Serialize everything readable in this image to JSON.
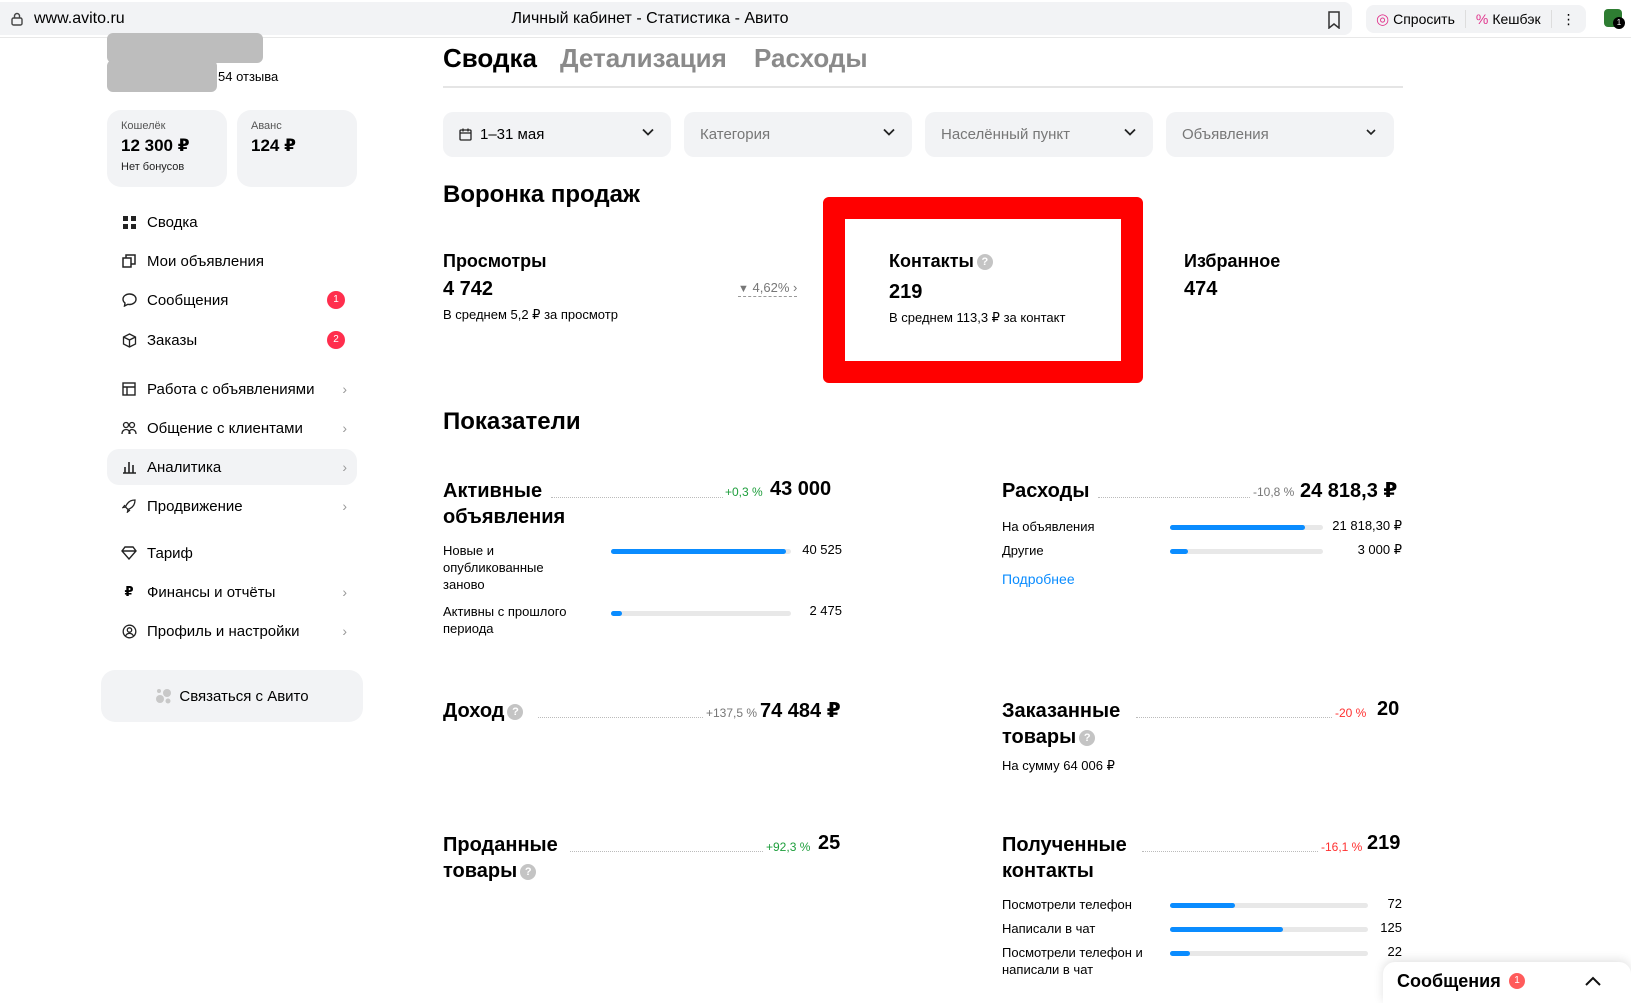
{
  "browser": {
    "url": "www.avito.ru",
    "title": "Личный кабинет - Статистика - Авито",
    "ask_label": "Спросить",
    "cashback_label": "Кешбэк",
    "menu_dots": "⋮",
    "ext_badge": "1"
  },
  "sidebar": {
    "reviews": "54 отзыва",
    "wallet": {
      "label": "Кошелёк",
      "value": "12 300 ₽",
      "sub": "Нет бонусов"
    },
    "advance": {
      "label": "Аванс",
      "value": "124 ₽"
    },
    "items": [
      {
        "label": "Сводка",
        "icon": "grid-icon"
      },
      {
        "label": "Мои объявления",
        "icon": "copy-icon"
      },
      {
        "label": "Сообщения",
        "icon": "chat-icon",
        "badge": "1"
      },
      {
        "label": "Заказы",
        "icon": "box-icon",
        "badge": "2"
      },
      {
        "label": "Работа с объявлениями",
        "icon": "listing-icon"
      },
      {
        "label": "Общение с клиентами",
        "icon": "people-icon"
      },
      {
        "label": "Аналитика",
        "icon": "chart-icon"
      },
      {
        "label": "Продвижение",
        "icon": "rocket-icon"
      },
      {
        "label": "Тариф",
        "icon": "diamond-icon"
      },
      {
        "label": "Финансы и отчёты",
        "icon": "ruble-icon"
      },
      {
        "label": "Профиль и настройки",
        "icon": "user-icon"
      }
    ],
    "contact_button": "Связаться с Авито"
  },
  "tabs": [
    "Сводка",
    "Детализация",
    "Расходы"
  ],
  "filters": {
    "date": "1–31 мая",
    "category": "Категория",
    "city": "Населённый пункт",
    "ads": "Объявления"
  },
  "funnel": {
    "title": "Воронка продаж",
    "views": {
      "label": "Просмотры",
      "value": "4 742",
      "sub": "В среднем 5,2 ₽ за просмотр"
    },
    "conversion": "4,62%",
    "contacts": {
      "label": "Контакты",
      "value": "219",
      "sub": "В среднем 113,3 ₽ за контакт"
    },
    "favorites": {
      "label": "Избранное",
      "value": "474"
    }
  },
  "indicators": {
    "title": "Показатели",
    "active_ads": {
      "title_line1": "Активные",
      "title_line2": "объявления",
      "change": "+0,3 %",
      "value": "43 000",
      "rows": [
        {
          "label": "Новые и опубликованные заново",
          "value": "40 525",
          "fill": 0.97
        },
        {
          "label": "Активны с прошлого периода",
          "value": "2 475",
          "fill": 0.06
        }
      ]
    },
    "expenses": {
      "title": "Расходы",
      "change": "-10,8 %",
      "value": "24 818,3 ₽",
      "rows": [
        {
          "label": "На объявления",
          "value": "21 818,30 ₽",
          "fill": 0.88
        },
        {
          "label": "Другие",
          "value": "3 000 ₽",
          "fill": 0.12
        }
      ],
      "more_link": "Подробнее"
    },
    "income": {
      "title": "Доход",
      "change": "+137,5 %",
      "value": "74 484 ₽"
    },
    "ordered": {
      "title_line1": "Заказанные",
      "title_line2": "товары",
      "change": "-20 %",
      "value": "20",
      "sub": "На сумму 64 006 ₽"
    },
    "sold": {
      "title_line1": "Проданные",
      "title_line2": "товары",
      "change": "+92,3 %",
      "value": "25"
    },
    "received_contacts": {
      "title_line1": "Полученные",
      "title_line2": "контакты",
      "change": "-16,1 %",
      "value": "219",
      "rows": [
        {
          "label": "Посмотрели телефон",
          "value": "72",
          "fill": 0.33
        },
        {
          "label": "Написали в чат",
          "value": "125",
          "fill": 0.57
        },
        {
          "label": "Посмотрели телефон и написали в чат",
          "value": "22",
          "fill": 0.1
        }
      ]
    }
  },
  "messages_bar": {
    "label": "Сообщения",
    "badge": "1"
  }
}
